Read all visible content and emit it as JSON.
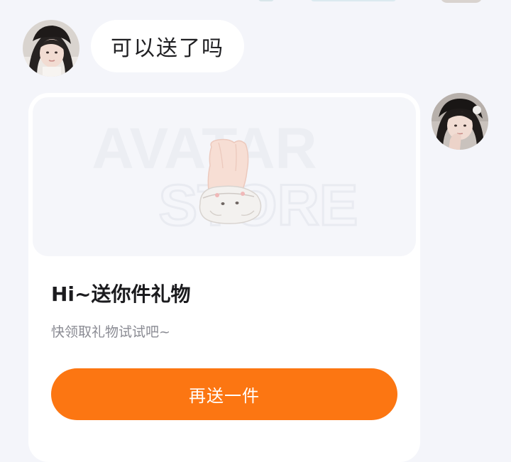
{
  "incoming_message": {
    "text": "可以送了吗"
  },
  "gift_card": {
    "watermark_line1": "AVATAR",
    "watermark_line2": "STORE",
    "title": "Hi~送你件礼物",
    "subtitle": "快领取礼物试试吧~",
    "button_label": "再送一件"
  },
  "colors": {
    "background": "#f4f5fa",
    "bubble": "#ffffff",
    "accent_orange": "#fc7612"
  }
}
